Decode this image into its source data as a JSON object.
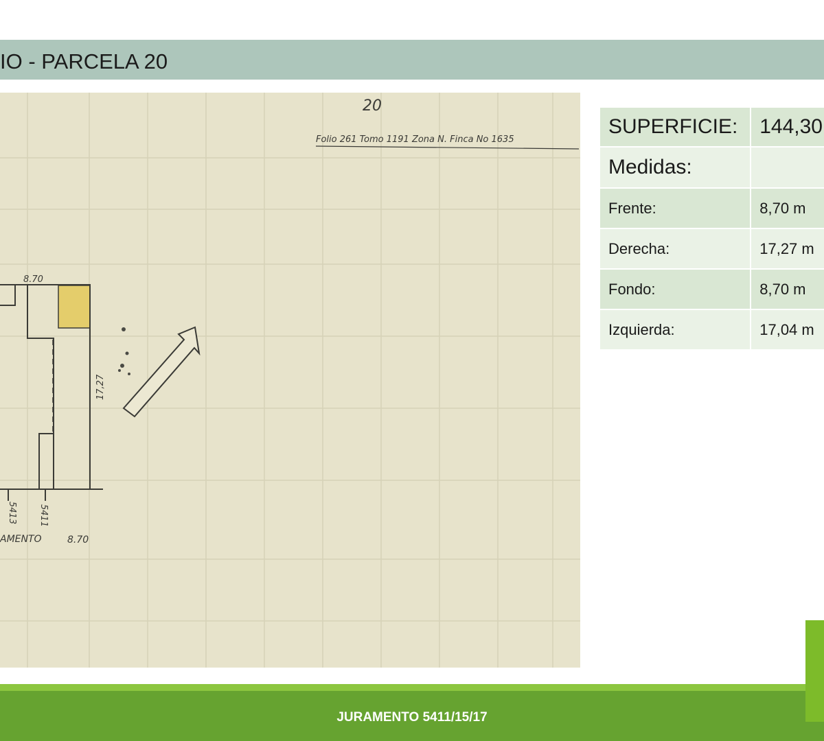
{
  "header": {
    "title": "IO - PARCELA 20"
  },
  "plan": {
    "parcel_number": "20",
    "registry_line": "Folio 261 Tomo 1191 Zona N. Finca No 1635",
    "top_measure": "8.70",
    "right_measure": "17,27",
    "bottom_number_a": "5413",
    "bottom_number_b": "5411",
    "street_label": "AMENTO",
    "bottom_measure": "8.70",
    "highlight_color": "#e4cd6b"
  },
  "info": {
    "superficie_label": "SUPERFICIE:",
    "superficie_value": "144,30",
    "medidas_label": "Medidas:",
    "rows": [
      {
        "label": "Frente:",
        "value": "8,70 m"
      },
      {
        "label": "Derecha:",
        "value": "17,27 m"
      },
      {
        "label": "Fondo:",
        "value": "8,70 m"
      },
      {
        "label": "Izquierda:",
        "value": "17,04 m"
      }
    ]
  },
  "footer": {
    "text": "JURAMENTO 5411/15/17"
  }
}
